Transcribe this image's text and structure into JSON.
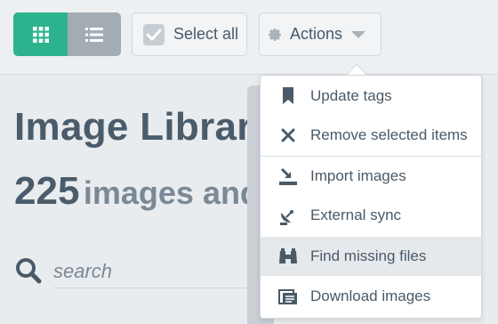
{
  "toolbar": {
    "grid_view_icon": "grid-icon",
    "list_view_icon": "list-icon",
    "select_all_label": "Select all",
    "actions_label": "Actions"
  },
  "page": {
    "title": "Image Library",
    "count": "225",
    "subtitle_rest": "images and"
  },
  "search": {
    "placeholder": "search"
  },
  "menu": {
    "items": [
      {
        "label": "Update tags",
        "icon": "bookmark-icon"
      },
      {
        "label": "Remove selected items",
        "icon": "close-icon"
      },
      {
        "label": "Import images",
        "icon": "import-icon"
      },
      {
        "label": "External sync",
        "icon": "satellite-icon"
      },
      {
        "label": "Find missing files",
        "icon": "binoculars-icon"
      },
      {
        "label": "Download images",
        "icon": "download-icon"
      }
    ]
  },
  "colors": {
    "accent": "#2db38e",
    "text": "#4a5a68",
    "highlight": "#e6e9ec"
  }
}
